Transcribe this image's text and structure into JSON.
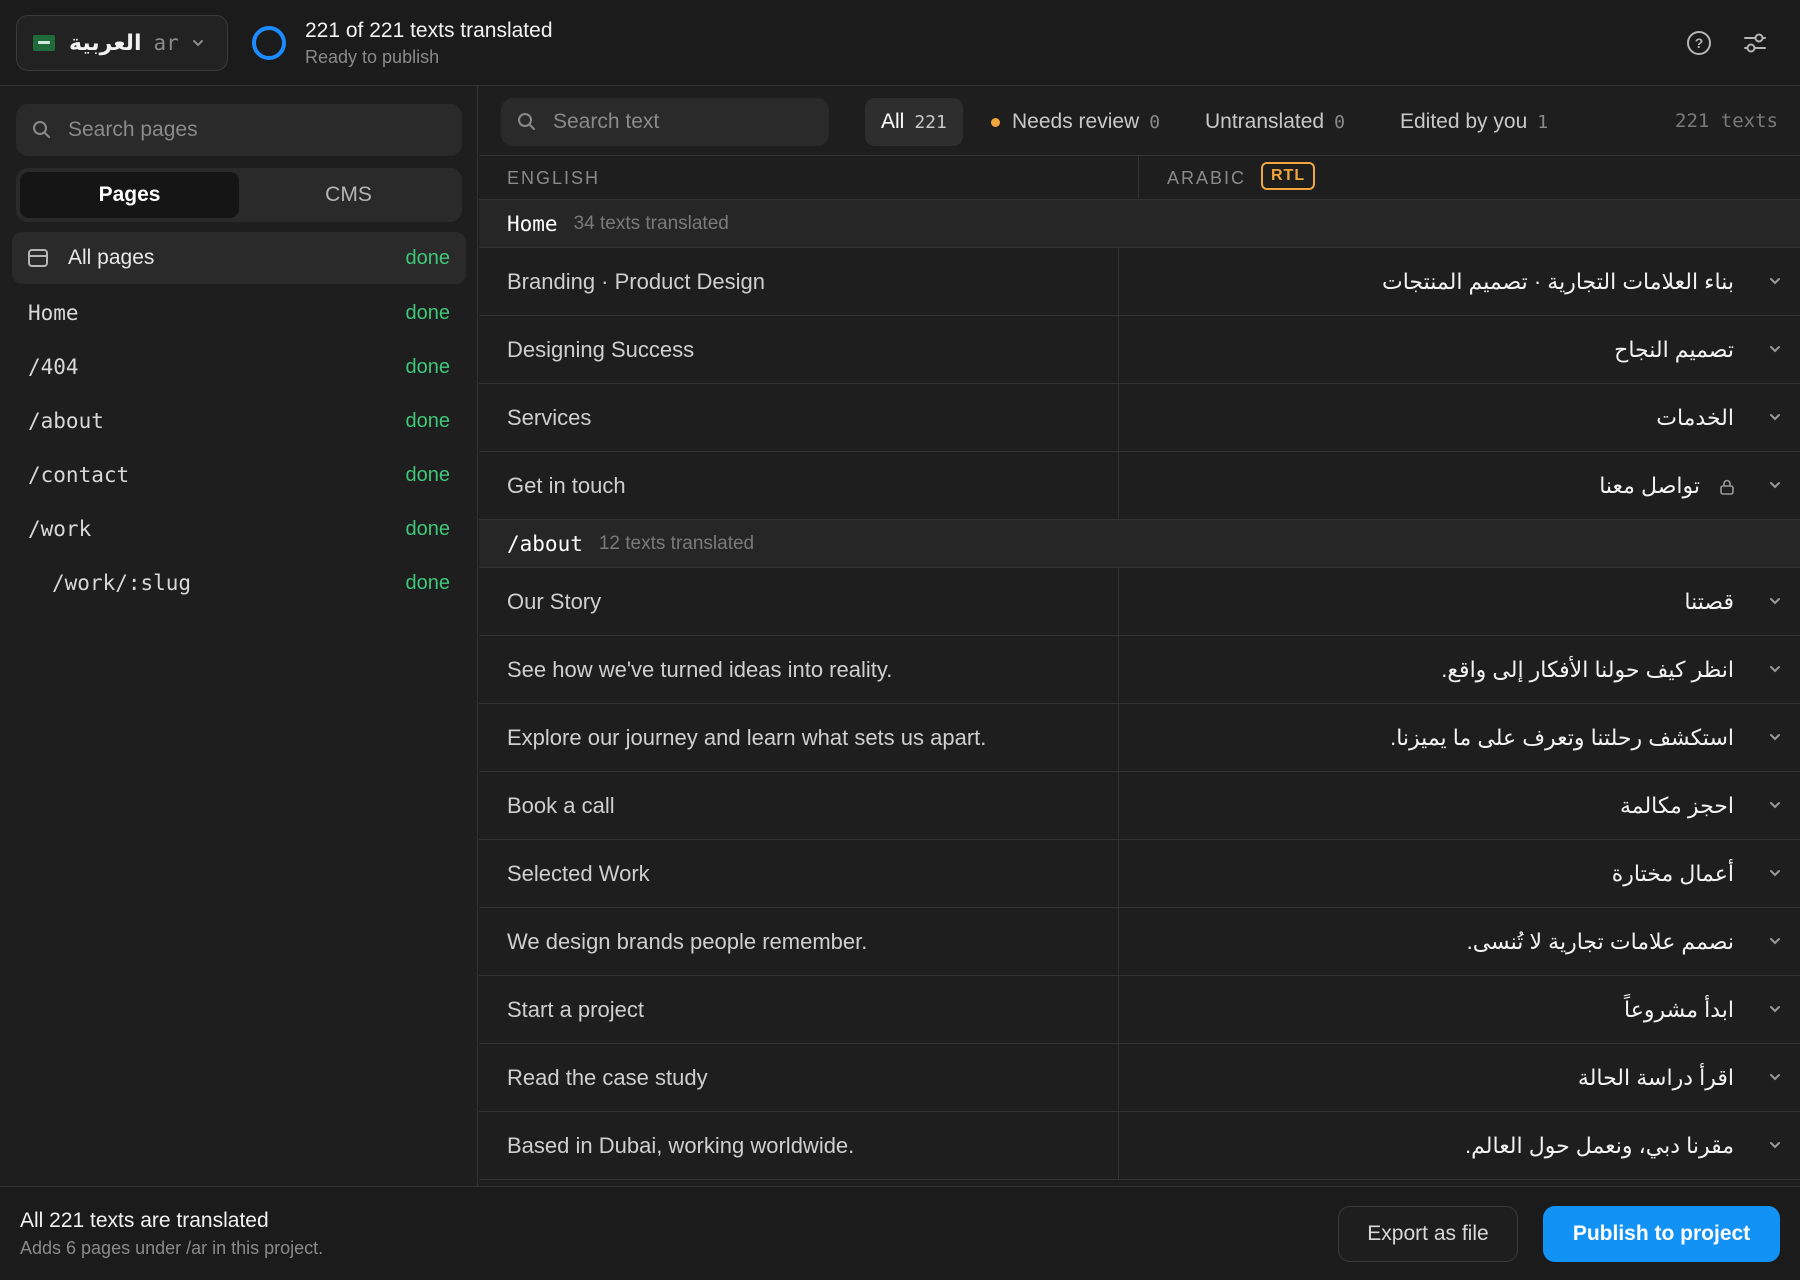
{
  "header": {
    "language_name": "العربية",
    "language_code": "ar",
    "status_title": "221 of 221 texts translated",
    "status_subtitle": "Ready to publish"
  },
  "sidebar": {
    "search_placeholder": "Search pages",
    "tabs": [
      {
        "label": "Pages",
        "active": true
      },
      {
        "label": "CMS",
        "active": false
      }
    ],
    "pages": [
      {
        "label": "All pages",
        "status": "done"
      },
      {
        "label": "Home",
        "status": "done"
      },
      {
        "label": "/404",
        "status": "done"
      },
      {
        "label": "/about",
        "status": "done"
      },
      {
        "label": "/contact",
        "status": "done"
      },
      {
        "label": "/work",
        "status": "done"
      },
      {
        "label": "/work/:slug",
        "status": "done"
      }
    ]
  },
  "filters": {
    "search_placeholder": "Search text",
    "items": [
      {
        "label": "All",
        "count": "221"
      },
      {
        "label": "Needs review",
        "count": "0"
      },
      {
        "label": "Untranslated",
        "count": "0"
      },
      {
        "label": "Edited by you",
        "count": "1"
      }
    ],
    "total": "221 texts"
  },
  "columns": {
    "source": "ENGLISH",
    "target": "ARABIC",
    "direction_badge": "RTL"
  },
  "groups": [
    {
      "name": "Home",
      "count_label": "34 texts translated",
      "rows": [
        {
          "en": "Branding · Product Design",
          "ar": "بناء العلامات التجارية · تصميم المنتجات"
        },
        {
          "en": "Designing Success",
          "ar": "تصميم النجاح"
        },
        {
          "en": "Services",
          "ar": "الخدمات"
        },
        {
          "en": "Get in touch",
          "ar": "تواصل معنا"
        }
      ]
    },
    {
      "name": "/about",
      "count_label": "12 texts translated",
      "rows": [
        {
          "en": "Our Story",
          "ar": "قصتنا"
        },
        {
          "en": "See how we've turned ideas into reality.",
          "ar": "انظر كيف حولنا الأفكار إلى واقع."
        },
        {
          "en": "Explore our journey and learn what sets us apart.",
          "ar": "استكشف رحلتنا وتعرف على ما يميزنا."
        },
        {
          "en": "Book a call",
          "ar": "احجز مكالمة"
        },
        {
          "en": "Selected Work",
          "ar": "أعمال مختارة"
        },
        {
          "en": "We design brands people remember.",
          "ar": "نصمم علامات تجارية لا تُنسى."
        },
        {
          "en": "Start a project",
          "ar": "ابدأ مشروعاً"
        },
        {
          "en": "Read the case study",
          "ar": "اقرأ دراسة الحالة"
        },
        {
          "en": "Based in Dubai, working worldwide.",
          "ar": "مقرنا دبي، ونعمل حول العالم."
        }
      ]
    }
  ],
  "footer": {
    "title": "All 221 texts are translated",
    "subtitle": "Adds 6 pages under /ar in this project.",
    "export_label": "Export as file",
    "publish_label": "Publish to project"
  },
  "colors": {
    "accent": "#1392f5",
    "done": "#3fc77a",
    "warning": "#f0a63a"
  }
}
